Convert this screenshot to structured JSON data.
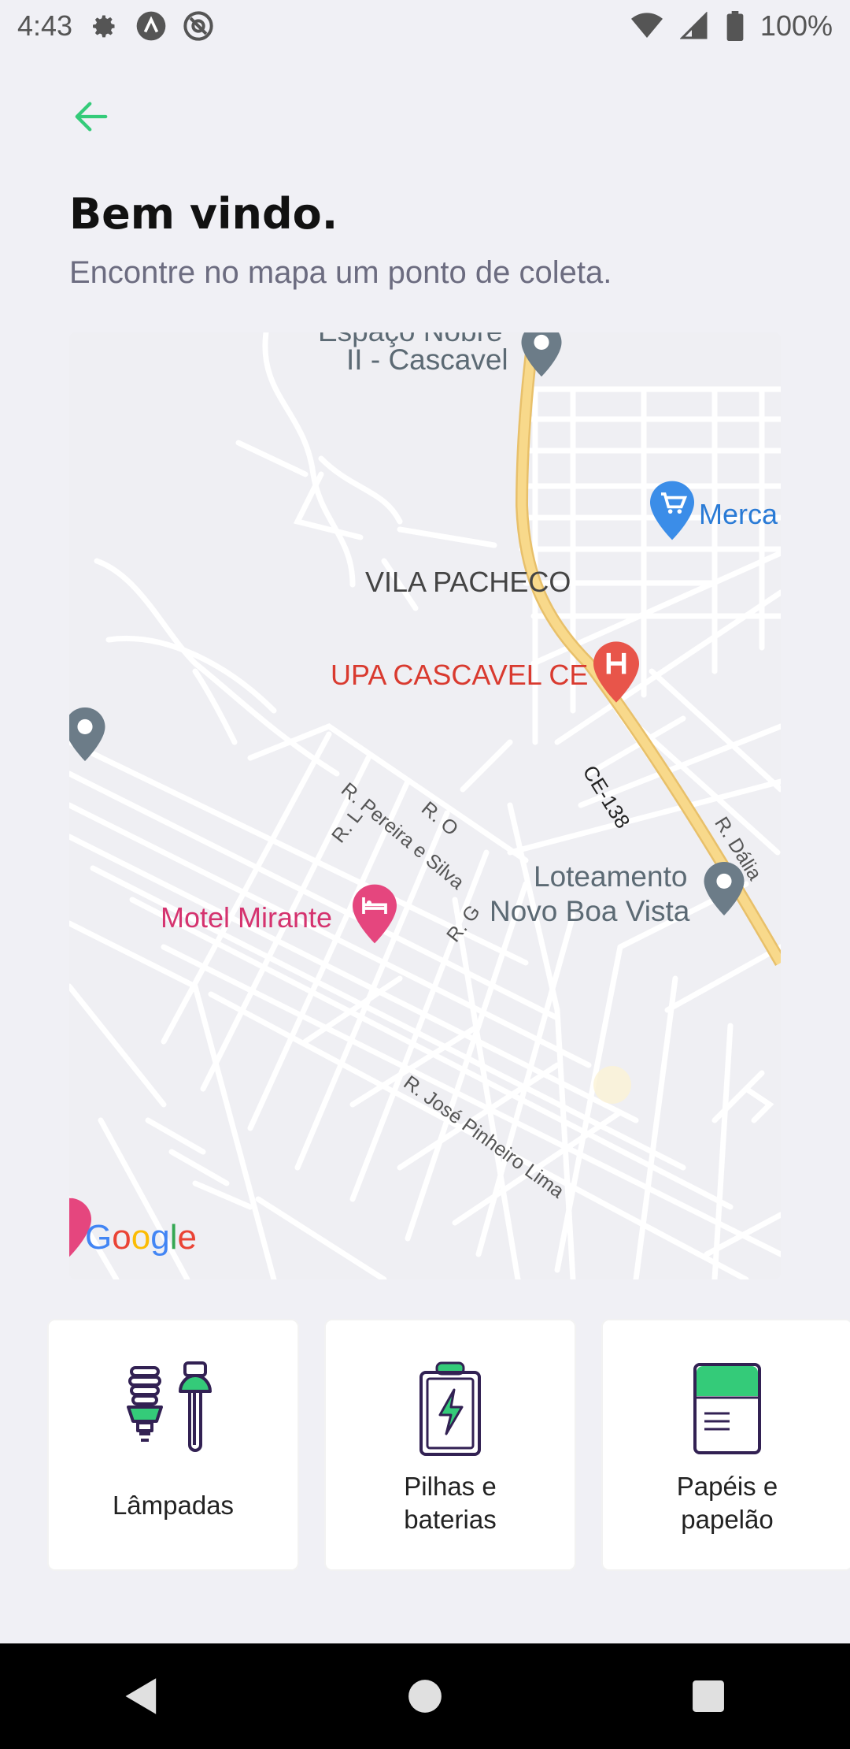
{
  "status_bar": {
    "time": "4:43",
    "battery": "100%",
    "icons": [
      "settings-icon",
      "app-a-icon",
      "at-sign-icon",
      "wifi-icon",
      "signal-icon",
      "battery-icon"
    ]
  },
  "header": {
    "back_icon": "arrow-left-icon",
    "title": "Bem vindo.",
    "subtitle": "Encontre no mapa um ponto de coleta."
  },
  "map": {
    "labels": {
      "espaco": "Espaço Nobre",
      "espaco2": "II - Cascavel",
      "mercado": "Merca",
      "vila": "VILA PACHECO",
      "upa": "UPA CASCAVEL CE",
      "ce138": "CE-138",
      "pereira": "R. Pereira e Silva",
      "ro": "R. O",
      "rl": "R. L",
      "rg": "R. G",
      "dalia": "R. Dália",
      "loteamento1": "Loteamento",
      "loteamento2": "Novo Boa Vista",
      "motel": "Motel Mirante",
      "jose": "R. José Pinheiro Lima"
    },
    "logo": "Google",
    "colors": {
      "highway": "#F8D98B",
      "poi_gray": "#6C7C88",
      "poi_red": "#E8554A",
      "poi_pink": "#E5467E",
      "poi_blue": "#3B8DE8"
    }
  },
  "items": [
    {
      "label": "Lâmpadas",
      "icon": "lamps-icon"
    },
    {
      "label_line1": "Pilhas e",
      "label_line2": "baterias",
      "icon": "battery-item-icon"
    },
    {
      "label_line1": "Papéis e",
      "label_line2": "papelão",
      "icon": "paper-icon"
    }
  ],
  "colors": {
    "accent": "#34CB79",
    "title": "#111111",
    "subtitle": "#6C6C80",
    "icon_outline": "#322153"
  },
  "nav": {
    "back": "nav-back-icon",
    "home": "nav-home-icon",
    "recents": "nav-recents-icon"
  }
}
